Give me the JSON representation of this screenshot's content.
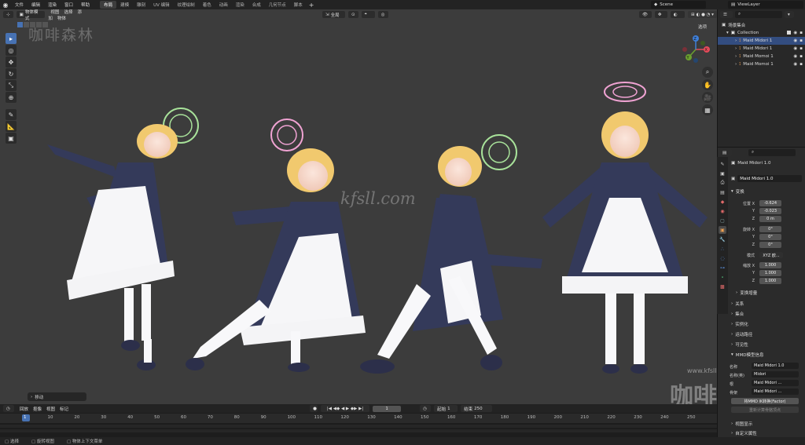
{
  "topbar": {
    "menus": [
      "文件",
      "编辑",
      "渲染",
      "窗口",
      "帮助"
    ],
    "workspaces": [
      "布局",
      "建模",
      "雕刻",
      "UV 编辑",
      "纹理绘制",
      "着色",
      "动画",
      "渲染",
      "合成",
      "几何节点",
      "脚本"
    ],
    "active_workspace": "布局",
    "plus": "+",
    "scene": "Scene",
    "view_layer": "ViewLayer"
  },
  "viewport_header": {
    "mode": "物体模式",
    "menus": [
      "视图",
      "选择",
      "添加",
      "物体"
    ],
    "transform_orientation": "全局",
    "options": "选项"
  },
  "viewport": {
    "watermark_cn": "咖啡森林",
    "watermark_url": "kfsll.com",
    "watermark_url_small": "www.kfsll.com",
    "watermark_logo": "咖啡森",
    "axis_labels": {
      "x": "X",
      "y": "Y",
      "z": "Z"
    },
    "last_operator": "移动"
  },
  "timeline": {
    "menus": [
      "回放",
      "抠像",
      "视图",
      "标记"
    ],
    "current_frame": "1",
    "start_label": "起始",
    "start": "1",
    "end_label": "结束",
    "end": "250",
    "ruler_ticks": [
      "1",
      "10",
      "20",
      "30",
      "40",
      "50",
      "60",
      "70",
      "80",
      "90",
      "100",
      "110",
      "120",
      "130",
      "140",
      "150",
      "160",
      "170",
      "180",
      "190",
      "200",
      "210",
      "220",
      "230",
      "240",
      "250"
    ]
  },
  "status": {
    "items": [
      "选择",
      "旋转视图",
      "物体上下文菜单"
    ]
  },
  "outliner": {
    "title": "场景集合",
    "collection": "Collection",
    "items": [
      {
        "label": "Maid Midori 1",
        "selected": true
      },
      {
        "label": "Maid Midori 1",
        "selected": false
      },
      {
        "label": "Maid Momoi 1",
        "selected": false
      },
      {
        "label": "Maid Momoi 1",
        "selected": false
      }
    ]
  },
  "properties": {
    "object_name": "Maid Midori 1.0",
    "object_field": "Maid Midori 1.0",
    "transform_title": "变换",
    "location_label": "位置 X",
    "location": [
      "-0.624",
      "-0.023",
      "0 m"
    ],
    "rotation_label": "旋转 X",
    "rotation": [
      "0°",
      "0°",
      "0°"
    ],
    "mode_label": "模式",
    "mode": "XYZ 欧...",
    "scale_label": "缩放 X",
    "scale": [
      "1.000",
      "1.000",
      "1.000"
    ],
    "y_label": "Y",
    "z_label": "Z",
    "delta_transform": "变换增量",
    "sections": [
      "关系",
      "集合",
      "实例化",
      "运动路径",
      "可见性"
    ],
    "mmd_title": "MMD模型信息",
    "name_label": "名称",
    "name_value": "Maid Midori 1.0",
    "name_en_label": "名称(英)",
    "name_en_value": "Midori",
    "root_label": "根",
    "root_value": "Maid Midori ...",
    "armature_label": "骨架",
    "armature_value": "Maid Midori ...",
    "mmd_button": "将MMD IK转换(Factor)",
    "mmd_button2": "重新计算骨骼顶点",
    "viewport_display": "视图显示",
    "custom_props": "自定义属性"
  },
  "colors": {
    "accent": "#4772b3",
    "selection": "#334d80",
    "viewport_bg": "#3c3c3c",
    "axis_x": "#e44b5a",
    "axis_y": "#6ba02f",
    "axis_z": "#3f7fd8"
  }
}
